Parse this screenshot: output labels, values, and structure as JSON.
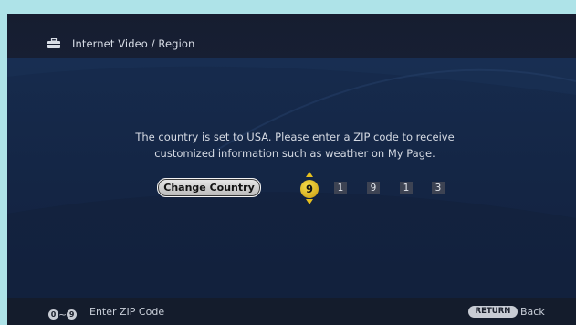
{
  "header": {
    "icon": "briefcase-icon",
    "title": "Internet Video / Region"
  },
  "main": {
    "message": "The country is set to USA. Please enter a ZIP code to receive\ncustomized information such as weather on My Page.",
    "change_country_label": "Change Country",
    "zip_digits": [
      "9",
      "1",
      "9",
      "1",
      "3"
    ],
    "active_digit_index": 0
  },
  "footer": {
    "key_start": "0",
    "key_end": "9",
    "tilde": "~",
    "hint": "Enter ZIP Code",
    "return_key": "RETURN",
    "back_label": "Back"
  },
  "colors": {
    "accent": "#e7c01e",
    "background": "#13203a"
  }
}
